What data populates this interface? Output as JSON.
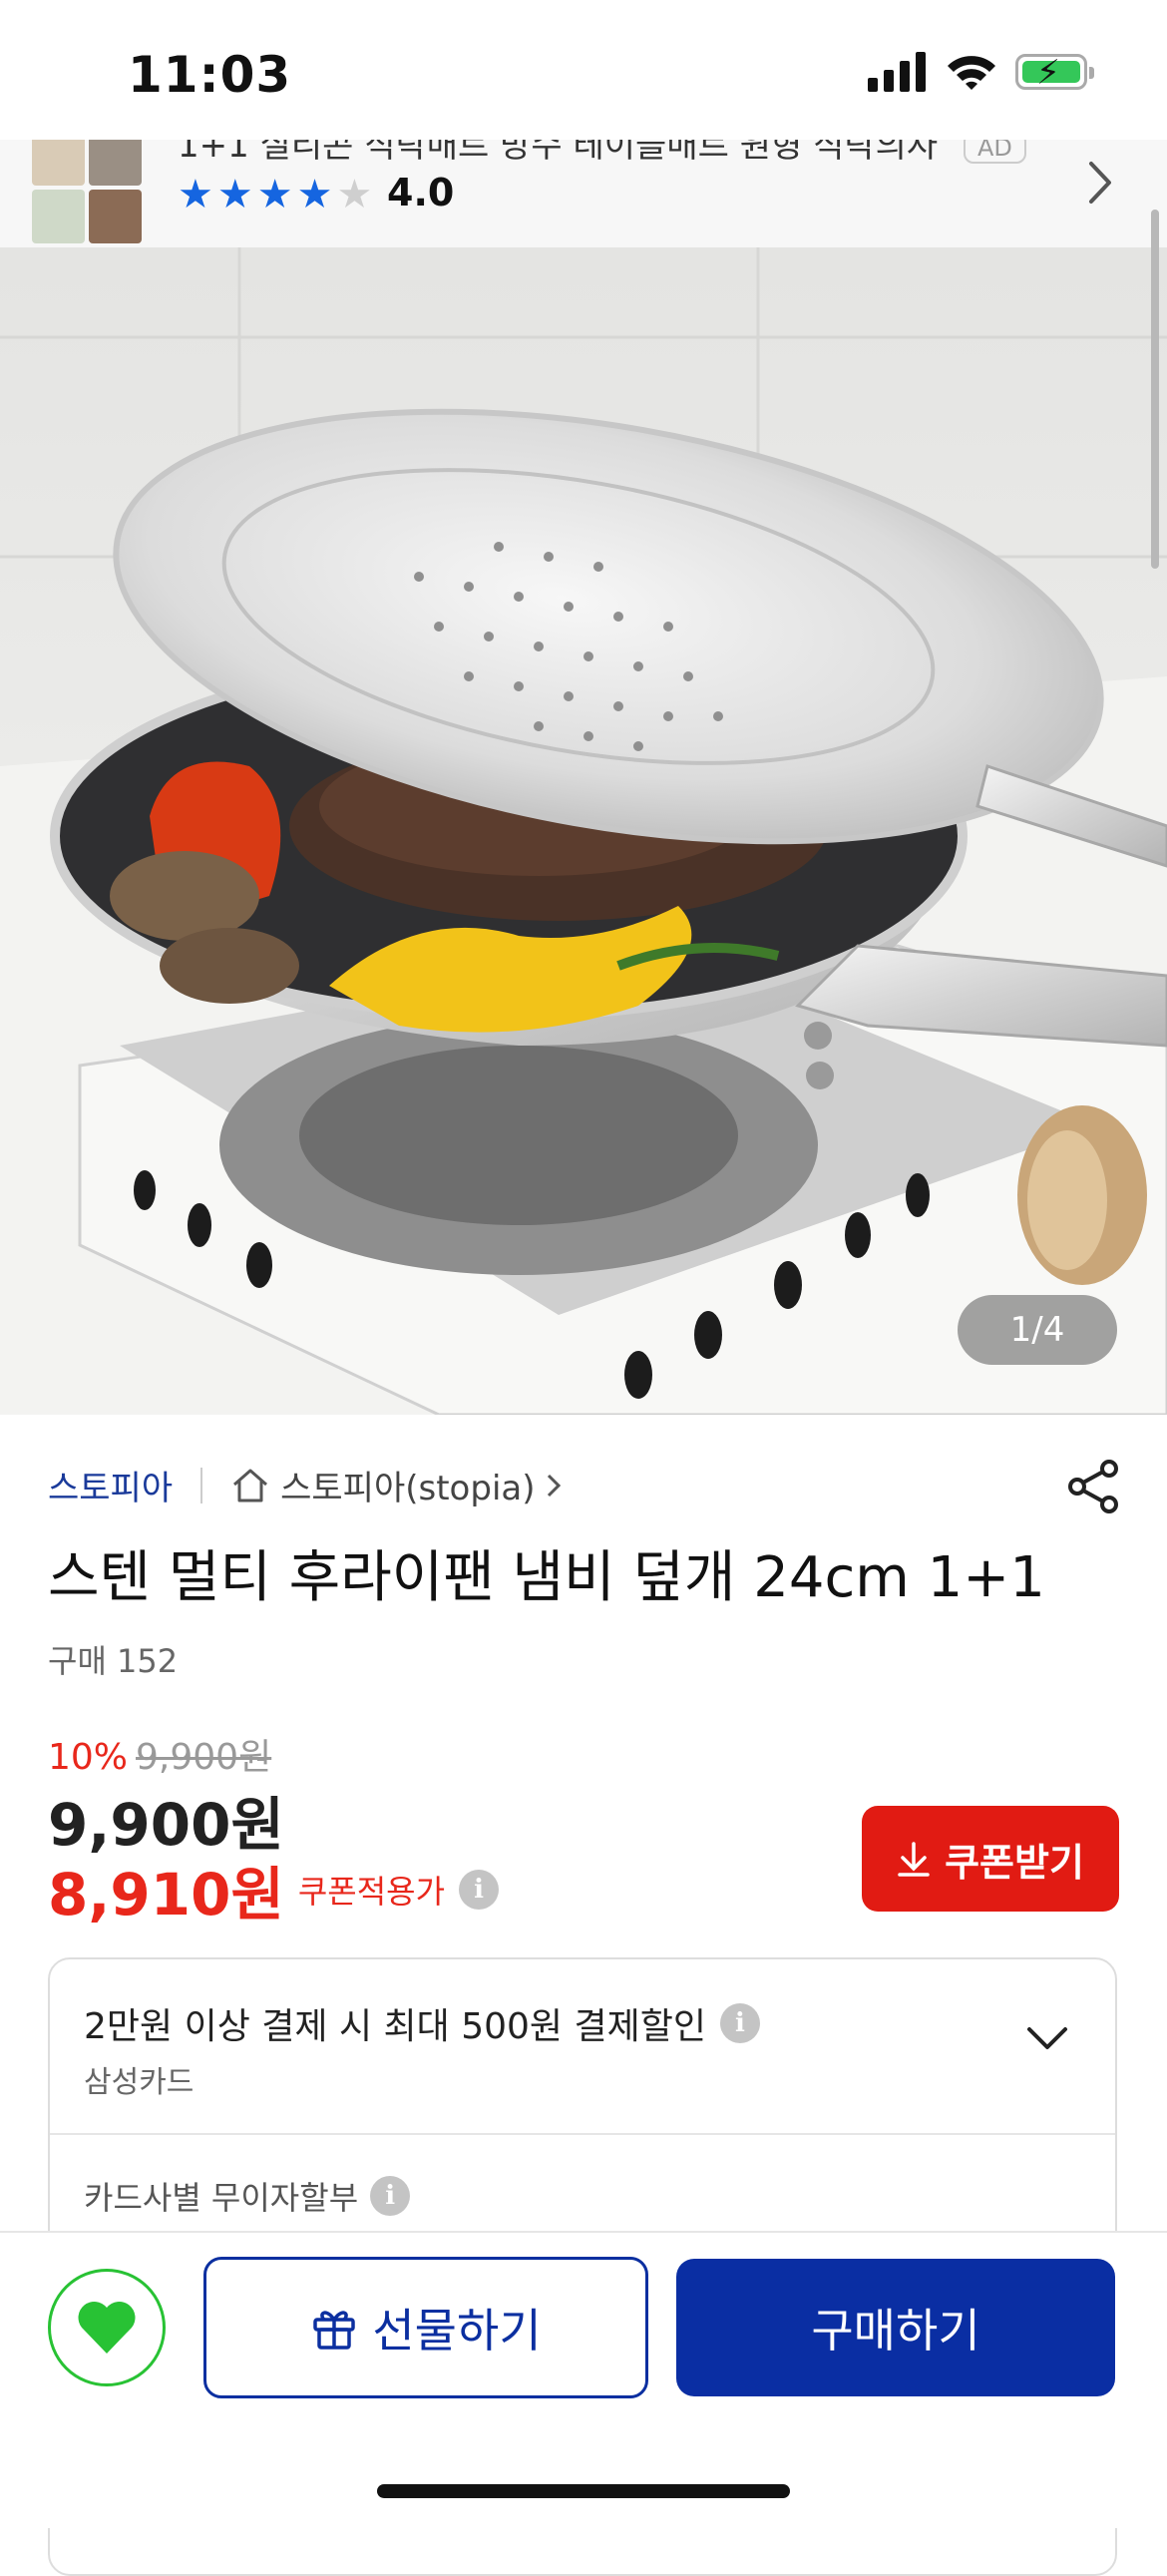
{
  "status_bar": {
    "time": "11:03"
  },
  "ad": {
    "title": "1+1 실리콘 식탁매트 방수 테이블매트 원형 식탁의자",
    "badge": "AD",
    "rating": "4.0",
    "stars_filled": 4,
    "stars_total": 5
  },
  "gallery": {
    "counter": "1/4"
  },
  "seller": {
    "brand": "스토피아",
    "store_name": "스토피아(stopia)"
  },
  "product": {
    "title": "스텐 멀티 후라이팬 냄비 덮개 24cm 1+1",
    "purchase_count": "구매 152"
  },
  "pricing": {
    "discount_rate": "10%",
    "original_price": "9,900원",
    "sale_price": "9,900원",
    "coupon_price": "8,910원",
    "coupon_price_label": "쿠폰적용가",
    "coupon_button": "쿠폰받기"
  },
  "benefits": {
    "card_discount": "2만원 이상 결제 시 최대 500원 결제할인",
    "card_name": "삼성카드",
    "installment": "카드사별 무이자할부"
  },
  "actions": {
    "gift": "선물하기",
    "buy": "구매하기"
  },
  "colors": {
    "accent_red": "#e11b13",
    "primary_blue": "#0a2ea3",
    "wish_green": "#28c234",
    "star_blue": "#1565e0"
  }
}
